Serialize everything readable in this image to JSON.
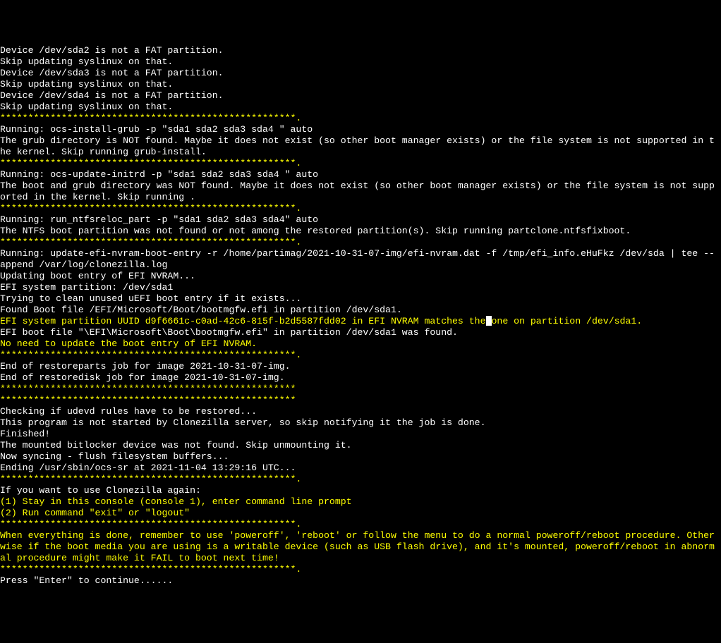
{
  "lines": [
    {
      "text": "Device /dev/sda2 is not a FAT partition.",
      "color": "white"
    },
    {
      "text": "Skip updating syslinux on that.",
      "color": "white"
    },
    {
      "text": "Device /dev/sda3 is not a FAT partition.",
      "color": "white"
    },
    {
      "text": "Skip updating syslinux on that.",
      "color": "white"
    },
    {
      "text": "Device /dev/sda4 is not a FAT partition.",
      "color": "white"
    },
    {
      "text": "Skip updating syslinux on that.",
      "color": "white"
    },
    {
      "text": "*****************************************************.",
      "color": "yellow"
    },
    {
      "text": "Running: ocs-install-grub -p \"sda1 sda2 sda3 sda4 \" auto",
      "color": "white"
    },
    {
      "text": "The grub directory is NOT found. Maybe it does not exist (so other boot manager exists) or the file system is not supported in the kernel. Skip running grub-install.",
      "color": "white"
    },
    {
      "text": "*****************************************************.",
      "color": "yellow"
    },
    {
      "text": "Running: ocs-update-initrd -p \"sda1 sda2 sda3 sda4 \" auto",
      "color": "white"
    },
    {
      "text": "The boot and grub directory was NOT found. Maybe it does not exist (so other boot manager exists) or the file system is not supported in the kernel. Skip running .",
      "color": "white"
    },
    {
      "text": "*****************************************************.",
      "color": "yellow"
    },
    {
      "text": "Running: run_ntfsreloc_part -p \"sda1 sda2 sda3 sda4\" auto",
      "color": "white"
    },
    {
      "text": "The NTFS boot partition was not found or not among the restored partition(s). Skip running partclone.ntfsfixboot.",
      "color": "white"
    },
    {
      "text": "*****************************************************.",
      "color": "yellow"
    },
    {
      "text": "Running: update-efi-nvram-boot-entry -r /home/partimag/2021-10-31-07-img/efi-nvram.dat -f /tmp/efi_info.eHuFkz /dev/sda | tee --append /var/log/clonezilla.log",
      "color": "white"
    },
    {
      "text": "Updating boot entry of EFI NVRAM...",
      "color": "white"
    },
    {
      "text": "EFI system partition: /dev/sda1",
      "color": "white"
    },
    {
      "text": "Trying to clean unused uEFI boot entry if it exists...",
      "color": "white"
    },
    {
      "text": "Found Boot file /EFI/Microsoft/Boot/bootmgfw.efi in partition /dev/sda1.",
      "color": "white"
    },
    {
      "text": "EFI system partition UUID d9f6661c-c0ad-42c6-815f-b2d5587fdd02 in EFI NVRAM matches the one on partition /dev/sda1.",
      "color": "yellow",
      "cursor_at": 87
    },
    {
      "text": "EFI boot file \"\\EFI\\Microsoft\\Boot\\bootmgfw.efi\" in partition /dev/sda1 was found.",
      "color": "white"
    },
    {
      "text": "No need to update the boot entry of EFI NVRAM.",
      "color": "yellow"
    },
    {
      "text": "*****************************************************.",
      "color": "yellow"
    },
    {
      "text": "End of restoreparts job for image 2021-10-31-07-img.",
      "color": "white"
    },
    {
      "text": "End of restoredisk job for image 2021-10-31-07-img.",
      "color": "white"
    },
    {
      "text": "*****************************************************",
      "color": "yellow"
    },
    {
      "text": "*****************************************************",
      "color": "yellow"
    },
    {
      "text": "Checking if udevd rules have to be restored...",
      "color": "white"
    },
    {
      "text": "This program is not started by Clonezilla server, so skip notifying it the job is done.",
      "color": "white"
    },
    {
      "text": "Finished!",
      "color": "white"
    },
    {
      "text": "The mounted bitlocker device was not found. Skip unmounting it.",
      "color": "white"
    },
    {
      "text": "Now syncing - flush filesystem buffers...",
      "color": "white"
    },
    {
      "text": "Ending /usr/sbin/ocs-sr at 2021-11-04 13:29:16 UTC...",
      "color": "white"
    },
    {
      "text": "*****************************************************.",
      "color": "yellow"
    },
    {
      "text": "If you want to use Clonezilla again:",
      "color": "white"
    },
    {
      "text": "(1) Stay in this console (console 1), enter command line prompt",
      "color": "yellow"
    },
    {
      "text": "(2) Run command \"exit\" or \"logout\"",
      "color": "yellow"
    },
    {
      "text": "*****************************************************.",
      "color": "yellow"
    },
    {
      "text": "When everything is done, remember to use 'poweroff', 'reboot' or follow the menu to do a normal poweroff/reboot procedure. Otherwise if the boot media you are using is a writable device (such as USB flash drive), and it's mounted, poweroff/reboot in abnormal procedure might make it FAIL to boot next time!",
      "color": "yellow"
    },
    {
      "text": "*****************************************************.",
      "color": "yellow"
    },
    {
      "text": "Press \"Enter\" to continue......",
      "color": "white"
    }
  ]
}
